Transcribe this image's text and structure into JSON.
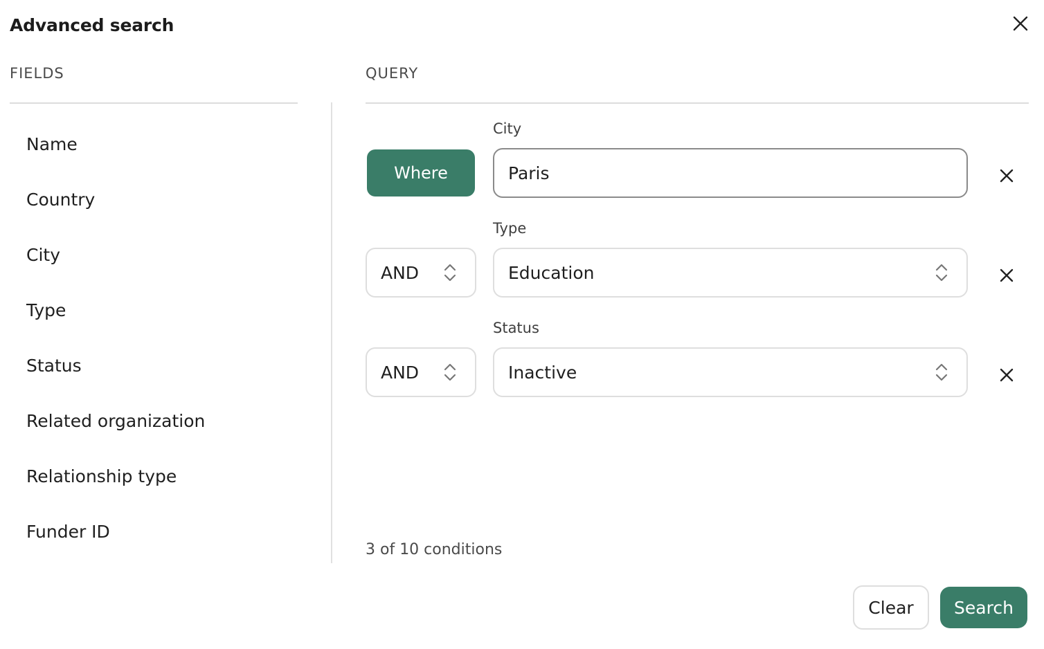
{
  "dialog": {
    "title": "Advanced search"
  },
  "fields_panel": {
    "label": "FIELDS",
    "items": [
      {
        "label": "Name"
      },
      {
        "label": "Country"
      },
      {
        "label": "City"
      },
      {
        "label": "Type"
      },
      {
        "label": "Status"
      },
      {
        "label": "Related organization"
      },
      {
        "label": "Relationship type"
      },
      {
        "label": "Funder ID"
      }
    ]
  },
  "query_panel": {
    "label": "QUERY",
    "conditions": [
      {
        "operator": "Where",
        "field": "City",
        "value": "Paris"
      },
      {
        "operator": "AND",
        "field": "Type",
        "value": "Education"
      },
      {
        "operator": "AND",
        "field": "Status",
        "value": "Inactive"
      }
    ],
    "count_text": "3 of 10 conditions"
  },
  "footer": {
    "clear_label": "Clear",
    "search_label": "Search"
  },
  "colors": {
    "accent": "#3a7d68",
    "border": "#dedede",
    "text": "#1f1f1f"
  },
  "icons": {
    "close": "close-icon",
    "remove": "remove-icon",
    "select": "chevron-up-down-icon"
  }
}
